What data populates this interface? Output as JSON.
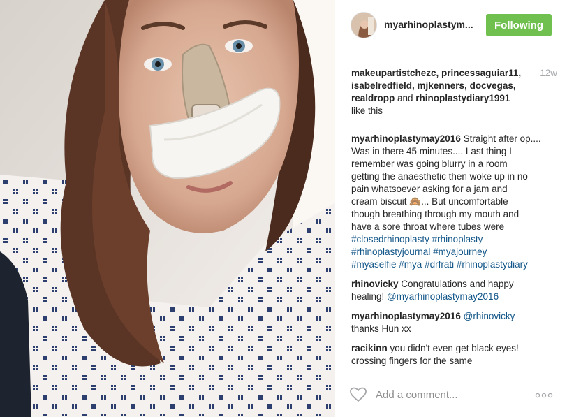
{
  "post": {
    "username": "myarhinoplastym...",
    "follow_label": "Following",
    "time_ago": "12w",
    "likes": {
      "line1": "makeupartistchezc, princessaguiar11,",
      "line2": "isabelredfield, mjkenners, docvegas,",
      "line3_names": "realdropp",
      "line3_and": " and ",
      "line3_last": "rhinoplastydiary1991",
      "suffix": "like this"
    },
    "caption": {
      "user": "myarhinoplastymay2016",
      "line1": " Straight after op....",
      "line2": "Was in there 45 minutes.... Last thing I",
      "line3": "remember was going blurry in a room",
      "line4": "getting the anaesthetic then woke up in no",
      "line5": "pain whatsoever asking for a jam and",
      "line6a": "cream biscuit ",
      "line6_emoji": "🙈",
      "line6b": "... But uncomfortable",
      "line7": "though breathing through my mouth and",
      "line8": "have a sore throat where tubes were",
      "tags_line1": [
        "#closedrhinoplasty",
        "#rhinoplasty"
      ],
      "tags_line2": [
        "#rhinoplastyjournal",
        "#myajourney"
      ],
      "tags_line3": [
        "#myaselfie",
        "#mya",
        "#drfrati",
        "#rhinoplastydiary"
      ]
    },
    "comments": [
      {
        "user": "rhinovicky",
        "text1": " Congratulations and happy",
        "text2": "healing! ",
        "mention": "@myarhinoplastymay2016"
      },
      {
        "user": "myarhinoplastymay2016",
        "mention": "@rhinovicky",
        "text2": "thanks Hun xx"
      },
      {
        "user": "racikinn",
        "text1": " you didn't even get black eyes!",
        "text2": "crossing fingers for the same"
      }
    ],
    "add_comment_placeholder": "Add a comment...",
    "icons": {
      "like": "heart-icon",
      "more": "more-options-icon"
    }
  },
  "colors": {
    "follow_button": "#70c050",
    "hashtag": "#125688",
    "timestamp": "#a5a7aa"
  }
}
